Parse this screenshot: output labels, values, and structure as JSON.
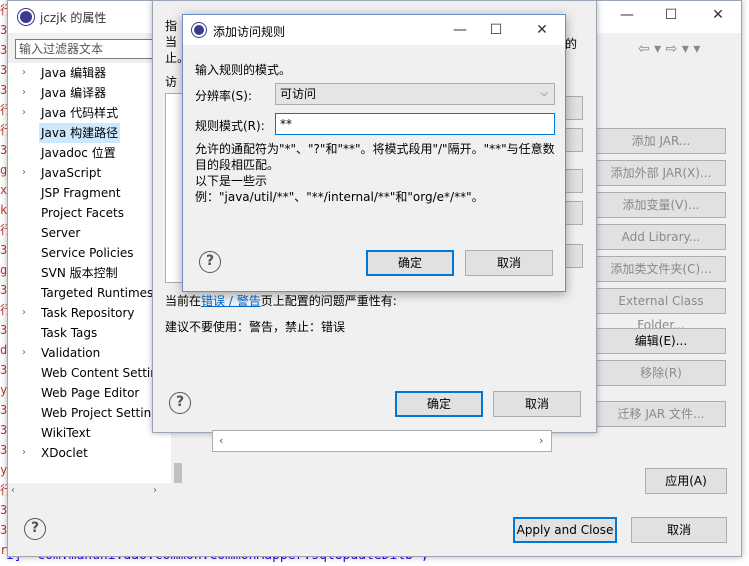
{
  "editor": {
    "gutter_chars": [
      "行",
      "3",
      "3",
      "3",
      "3",
      "行",
      "行",
      "3",
      "g",
      "x",
      "k",
      "行",
      "3",
      "g",
      "3",
      "行",
      "3",
      "d",
      "3",
      "y",
      "3",
      "3",
      "3",
      "y",
      "行",
      "3",
      "3",
      "r"
    ],
    "bottom_line": "i]=\"com.manuni.dao.common.CommonMapper.sqlUpdateDilb\";"
  },
  "properties_window": {
    "title": "jczjk 的属性",
    "filter_placeholder": "输入过滤器文本",
    "tree": [
      {
        "label": "Java 编辑器",
        "arrow": "›"
      },
      {
        "label": "Java 编译器",
        "arrow": "›"
      },
      {
        "label": "Java 代码样式",
        "arrow": "›"
      },
      {
        "label": "Java 构建路径",
        "arrow": "",
        "selected": true
      },
      {
        "label": "Javadoc 位置",
        "arrow": ""
      },
      {
        "label": "JavaScript",
        "arrow": "›"
      },
      {
        "label": "JSP Fragment",
        "arrow": ""
      },
      {
        "label": "Project Facets",
        "arrow": ""
      },
      {
        "label": "Server",
        "arrow": ""
      },
      {
        "label": "Service Policies",
        "arrow": ""
      },
      {
        "label": "SVN 版本控制",
        "arrow": ""
      },
      {
        "label": "Targeted Runtimes",
        "arrow": ""
      },
      {
        "label": "Task Repository",
        "arrow": "›"
      },
      {
        "label": "Task Tags",
        "arrow": ""
      },
      {
        "label": "Validation",
        "arrow": "›"
      },
      {
        "label": "Web Content Settin",
        "arrow": ""
      },
      {
        "label": "Web Page Editor",
        "arrow": ""
      },
      {
        "label": "Web Project Setting",
        "arrow": ""
      },
      {
        "label": "WikiText",
        "arrow": ""
      },
      {
        "label": "XDoclet",
        "arrow": "›"
      }
    ],
    "nav_arrows": "⇦ ▾ ⇨ ▾ ▾",
    "side_buttons": [
      "添加 JAR...",
      "添加外部 JAR(X)...",
      "添加变量(V)...",
      "Add Library...",
      "添加类文件夹(C)...",
      "External Class Folder...",
      "编辑(E)...",
      "移除(R)",
      "迁移 JAR 文件..."
    ],
    "apply_label": "应用(A)",
    "apply_close_label": "Apply and Close",
    "cancel_label": "取消"
  },
  "middle_dialog": {
    "frag_1": "指",
    "frag_2": "当",
    "frag_3": "止。",
    "frag_4": "访",
    "frag_right": "的",
    "config_prefix": "当前在",
    "config_link": "错误 / 警告",
    "config_suffix": "页上配置的问题严重性有:",
    "advice": "建议不要使用：警告，禁止：错误",
    "ok_label": "确定",
    "cancel_label": "取消"
  },
  "top_dialog": {
    "title": "添加访问规则",
    "prompt": "输入规则的模式。",
    "resolution_label": "分辨率(S):",
    "resolution_value": "可访问",
    "pattern_label": "规则模式(R):",
    "pattern_value": "**",
    "desc_line1": "允许的通配符为\"*\"、\"?\"和\"**\"。将模式段用\"/\"隔开。\"**\"与任意数",
    "desc_line2": "目的段相匹配。",
    "desc_line3": "以下是一些示例：\"java/util/**\"、\"**/internal/**\"和\"org/e*/**\"。",
    "ok_label": "确定",
    "cancel_label": "取消"
  }
}
